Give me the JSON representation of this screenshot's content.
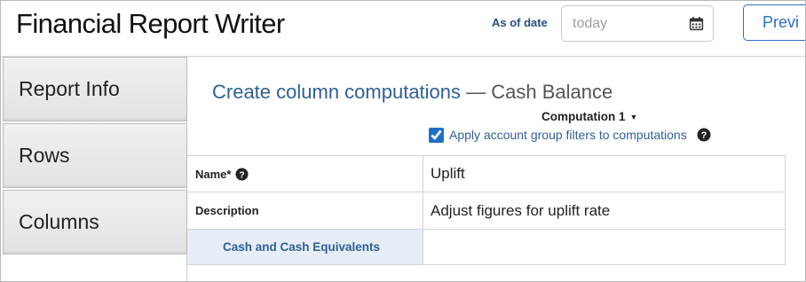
{
  "header": {
    "app_title": "Financial Report Writer",
    "as_of_label": "As of date",
    "date_placeholder": "today",
    "preview_label": "Previ"
  },
  "sidebar": {
    "items": [
      {
        "label": "Report Info"
      },
      {
        "label": "Rows"
      },
      {
        "label": "Columns"
      }
    ]
  },
  "main": {
    "title": "Create column computations",
    "separator": "—",
    "subtitle": "Cash Balance",
    "computation_select": "Computation 1",
    "apply_filters": {
      "label": "Apply account group filters to computations",
      "checked": true
    }
  },
  "form": {
    "name_label": "Name*",
    "name_value": "Uplift",
    "description_label": "Description",
    "description_value": "Adjust figures for uplift rate",
    "group_label": "Cash and Cash Equivalents",
    "group_value": ""
  },
  "colors": {
    "accent": "#2a6fc2",
    "title_blue": "#2f5f95",
    "row_highlight": "#e6edf6"
  },
  "icons": [
    "calendar-icon",
    "help-icon",
    "chevron-down-icon"
  ]
}
